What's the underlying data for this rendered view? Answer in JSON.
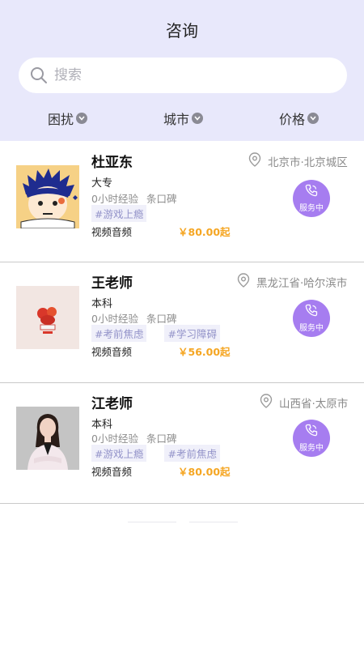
{
  "header": {
    "title": "咨询",
    "search_placeholder": "搜索",
    "filters": [
      {
        "label": "困扰"
      },
      {
        "label": "城市"
      },
      {
        "label": "价格"
      }
    ]
  },
  "counselors": [
    {
      "name": "杜亚东",
      "location": "北京市·北京城区",
      "education": "大专",
      "experience": "0小时经验",
      "reviews": "条口碑",
      "tags": [
        "#游戏上瘾"
      ],
      "mode": "视频音频",
      "price": "￥80.00起",
      "service_label": "服务中"
    },
    {
      "name": "王老师",
      "location": "黑龙江省·哈尔滨市",
      "education": "本科",
      "experience": "0小时经验",
      "reviews": "条口碑",
      "tags": [
        "#考前焦虑",
        "#学习障碍"
      ],
      "mode": "视频音频",
      "price": "￥56.00起",
      "service_label": "服务中"
    },
    {
      "name": "江老师",
      "location": "山西省·太原市",
      "education": "本科",
      "experience": "0小时经验",
      "reviews": "条口碑",
      "tags": [
        "#游戏上瘾",
        "#考前焦虑"
      ],
      "mode": "视频音频",
      "price": "￥80.00起",
      "service_label": "服务中"
    }
  ],
  "colors": {
    "header_bg": "#e8e8fb",
    "accent_purple": "#a67df0",
    "price_orange": "#f5a623",
    "tag_text": "#9393c9"
  },
  "icons": {
    "search": "search-icon",
    "location": "location-pin-icon",
    "phone": "phone-icon",
    "chevron": "chevron-down-icon"
  }
}
